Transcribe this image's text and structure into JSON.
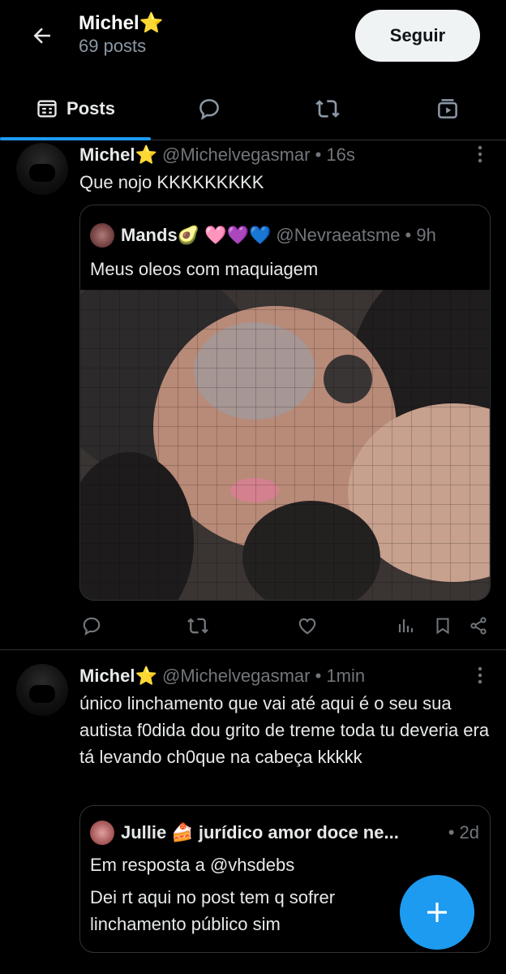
{
  "header": {
    "title": "Michel⭐",
    "post_count": "69 posts",
    "follow_label": "Seguir"
  },
  "tabs": [
    {
      "label": "Posts",
      "icon": "posts-icon",
      "selected": true
    },
    {
      "label": "",
      "icon": "replies-icon"
    },
    {
      "label": "",
      "icon": "reposts-icon"
    },
    {
      "label": "",
      "icon": "media-icon"
    }
  ],
  "tweets": [
    {
      "name": "Michel⭐",
      "handle": "@Michelvegasmar",
      "time": "• 16s",
      "text": "Que nojo KKKKKKKKK",
      "quote": {
        "name": "Mands🥑 🩷💜💙",
        "handle": "@Nevraeatsme",
        "time": "• 9h",
        "text": "Meus oleos com maquiagem",
        "image": "pixelated-face-photo"
      }
    },
    {
      "name": "Michel⭐",
      "handle": "@Michelvegasmar",
      "time": "• 1min",
      "text": "único linchamento que vai até aqui é o seu sua autista f0dida dou grito de treme toda tu deveria era tá levando ch0que na cabeça kkkkk",
      "quote": {
        "name": "Jullie 🍰 jurídico amor doce ne...",
        "time": "• 2d",
        "reply_to": "Em resposta a @vhsdebs",
        "text_line1": "Dei rt aqui no post tem q sofrer",
        "text_line2": "linchamento público sim"
      }
    }
  ],
  "colors": {
    "accent": "#1d9bf0",
    "background": "#000000",
    "secondary_text": "#71767b"
  },
  "fab_icon": "plus-icon"
}
